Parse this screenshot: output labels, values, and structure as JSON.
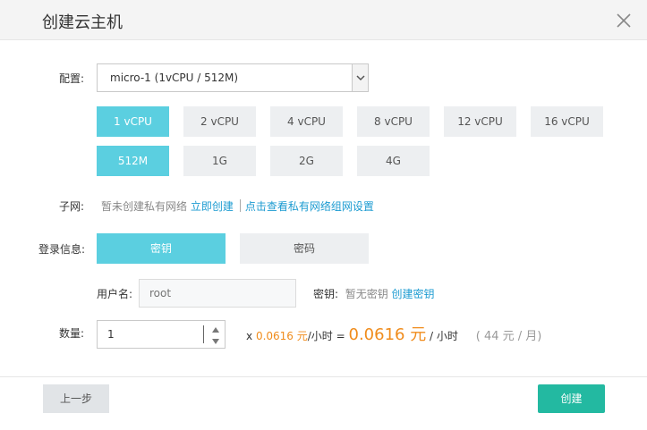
{
  "dialog": {
    "title": "创建云主机"
  },
  "config": {
    "label": "配置:",
    "selected": "micro-1 (1vCPU / 512M)",
    "cpu_options": [
      "1 vCPU",
      "2 vCPU",
      "4 vCPU",
      "8 vCPU",
      "12 vCPU",
      "16 vCPU"
    ],
    "mem_options": [
      "512M",
      "1G",
      "2G",
      "4G"
    ]
  },
  "subnet": {
    "label": "子网:",
    "note": "暂未创建私有网络",
    "create_link": "立即创建",
    "view_link": "点击查看私有网络组网设置"
  },
  "login": {
    "label": "登录信息:",
    "tab_key": "密钥",
    "tab_password": "密码",
    "username_label": "用户名:",
    "username_placeholder": "root",
    "key_label": "密钥:",
    "key_status": "暂无密钥",
    "key_create_link": "创建密钥"
  },
  "quantity": {
    "label": "数量:",
    "value": "1"
  },
  "price": {
    "x": "x",
    "unit_price": "0.0616 元",
    "per_hour": "/小时 =",
    "total": "0.0616 元",
    "per_hour_total": "/ 小时",
    "monthly": "( 44 元 / 月)"
  },
  "footer": {
    "prev": "上一步",
    "create": "创建"
  },
  "colors": {
    "accent": "#5bcfe0",
    "primary_button": "#23b9a1",
    "link": "#1c9bd1",
    "price": "#f08c1c"
  }
}
